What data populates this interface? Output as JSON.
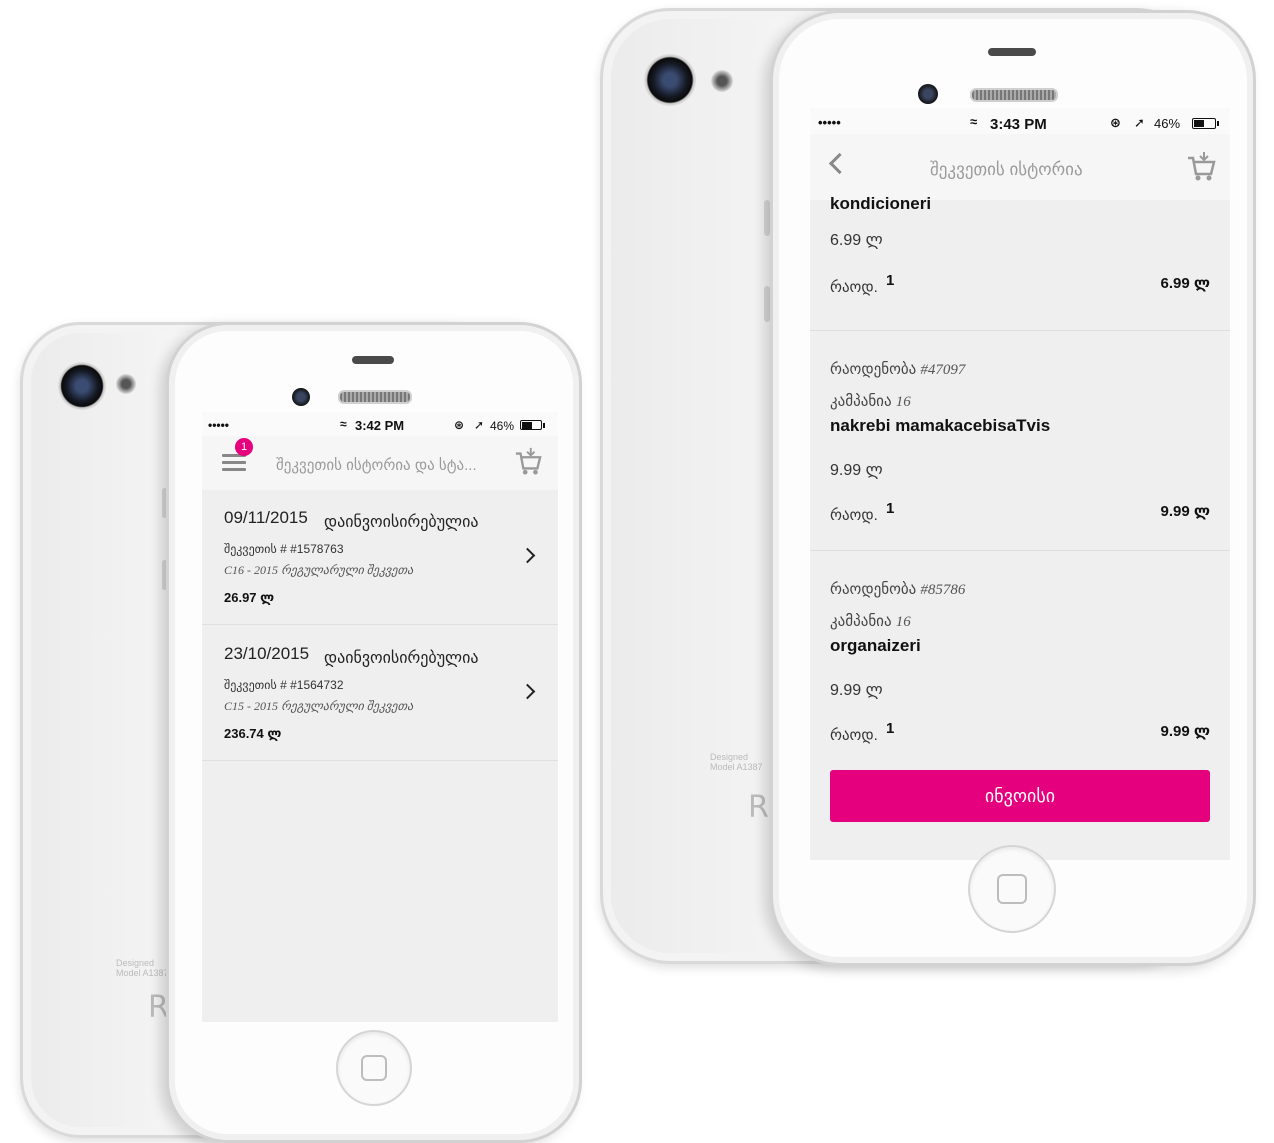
{
  "accent_color": "#e5007e",
  "left_phone": {
    "status": {
      "signal": "•••••",
      "time": "3:42 PM",
      "battery": "46%"
    },
    "nav": {
      "title": "შეკვეთის ისტორია და სტა...",
      "cart_badge_count": "1",
      "menu_icon": "hamburger-icon",
      "cart_icon": "cart-icon"
    },
    "orders": [
      {
        "date": "09/11/2015",
        "status": "დაინვოისირებულია",
        "order_no": "შეკვეთის # #1578763",
        "campaign": "C16 - 2015 რეგულარული შეკვეთა",
        "total": "26.97 ლ"
      },
      {
        "date": "23/10/2015",
        "status": "დაინვოისირებულია",
        "order_no": "შეკვეთის # #1564732",
        "campaign": "C15 - 2015 რეგულარული შეკვეთა",
        "total": "236.74 ლ"
      }
    ]
  },
  "right_phone": {
    "status": {
      "signal": "•••••",
      "time": "3:43 PM",
      "battery": "46%"
    },
    "nav": {
      "title": "შეკვეთის ისტორია",
      "back_icon": "back-chevron-icon",
      "cart_icon": "cart-icon"
    },
    "items": [
      {
        "partial_name": "kondicioneri",
        "price": "6.99 ლ",
        "qty_label": "რაოდ.",
        "qty": "1",
        "line_total": "6.99 ლ"
      },
      {
        "code_label": "რაოდენობა",
        "code": "#47097",
        "campaign_label": "კამპანია",
        "campaign": "16",
        "name": "nakrebi mamakacebisaTvis",
        "price": "9.99 ლ",
        "qty_label": "რაოდ.",
        "qty": "1",
        "line_total": "9.99 ლ"
      },
      {
        "code_label": "რაოდენობა",
        "code": "#85786",
        "campaign_label": "კამპანია",
        "campaign": "16",
        "name": "organaizeri",
        "price": "9.99 ლ",
        "qty_label": "რაოდ.",
        "qty": "1",
        "line_total": "9.99 ლ"
      }
    ],
    "invoice_button": "ინვოისი"
  }
}
